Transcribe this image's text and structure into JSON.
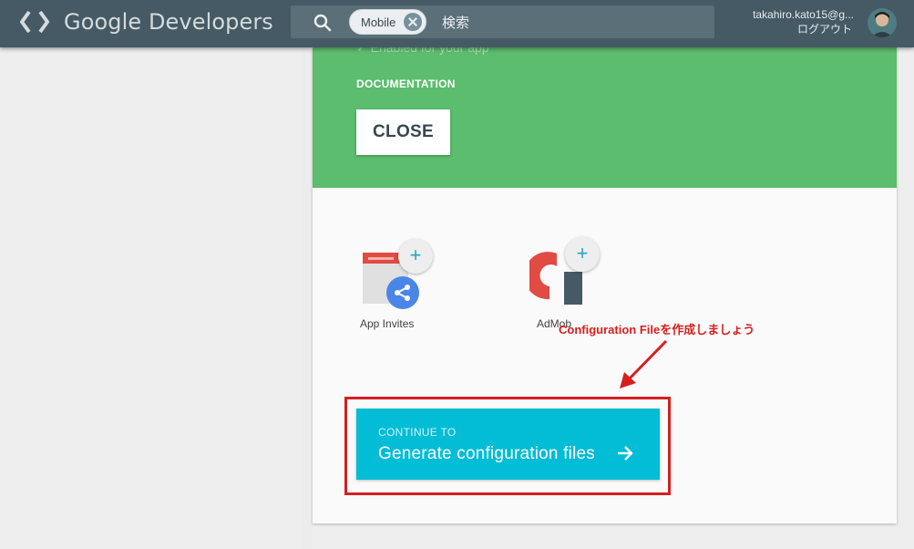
{
  "header": {
    "logo_text": "Google Developers",
    "search": {
      "chip_label": "Mobile",
      "query": "検索"
    },
    "user": {
      "email": "takahiro.kato15@g...",
      "logout_label": "ログアウト"
    }
  },
  "green_panel": {
    "enabled_text": "Enabled for your app",
    "documentation_label": "DOCUMENTATION",
    "close_label": "CLOSE"
  },
  "services": [
    {
      "label": "App Invites",
      "add_label": "+"
    },
    {
      "label": "AdMob",
      "add_label": "+"
    }
  ],
  "continue": {
    "small_label": "CONTINUE TO",
    "main_label": "Generate configuration files"
  },
  "annotation": {
    "text": "Configuration Fileを作成しましょう",
    "color": "#d61f1f"
  },
  "colors": {
    "header": "#455a64",
    "green": "#5cbd6e",
    "cyan": "#03bcd5"
  }
}
